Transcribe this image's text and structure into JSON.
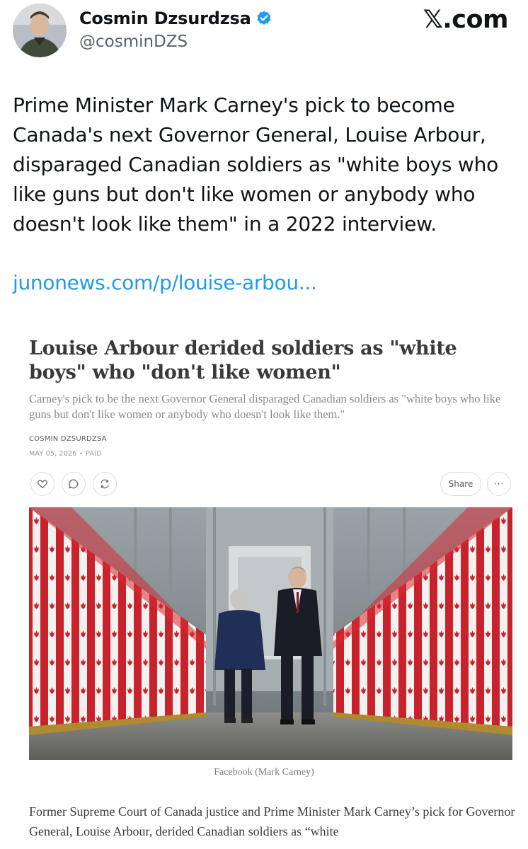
{
  "tweet": {
    "author_name": "Cosmin Dzsurdzsa",
    "handle": "@cosminDZS",
    "brand": "𝕏.com",
    "text": "Prime Minister Mark Carney's pick to become Canada's next Governor General, Louise Arbour, disparaged Canadian soldiers as \"white boys who like guns but don't like women or anybody who doesn't look like them\" in a 2022 interview.",
    "link": "junonews.com/p/louise-arbou..."
  },
  "article": {
    "title": "Louise Arbour derided soldiers as \"white boys\" who \"don't like women\"",
    "subtitle": "Carney's pick to be the next Governor General disparaged Canadian soldiers as \"white boys who like guns but don't like women or anybody who doesn't look like them.\"",
    "byline": "COSMIN DZSURDZSA",
    "date": "MAY 05, 2026 ∙ PAID",
    "share_label": "Share",
    "more_label": "···",
    "photo_caption": "Facebook (Mark Carney)",
    "body": "Former Supreme Court of Canada justice and Prime Minister Mark Carney’s pick for Governor General, Louise Arbour, derided Canadian soldiers as “white"
  },
  "icons": {
    "verified": "verified-badge-icon",
    "like": "heart-icon",
    "comment": "comment-icon",
    "restack": "restack-icon"
  },
  "colors": {
    "link": "#1d9bf0",
    "verified": "#1d9bf0",
    "flag_red": "#c8232c"
  }
}
